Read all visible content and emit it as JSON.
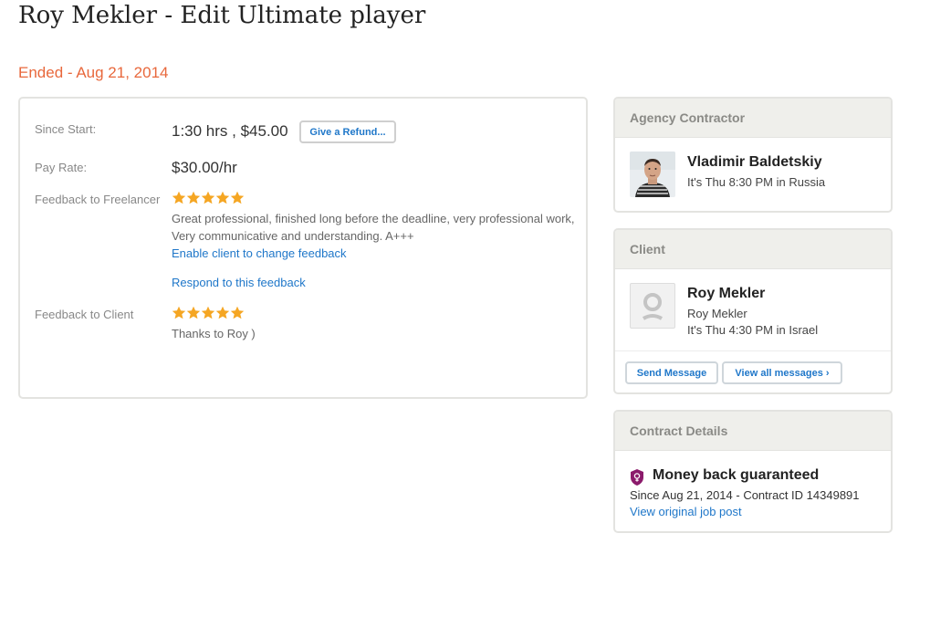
{
  "page": {
    "title": "Roy Mekler - Edit Ultimate player",
    "status": "Ended - Aug 21, 2014"
  },
  "summary": {
    "since_start_label": "Since Start:",
    "since_start_value": "1:30 hrs , $45.00",
    "refund_button": "Give a Refund...",
    "pay_rate_label": "Pay Rate:",
    "pay_rate_value": "$30.00/hr",
    "feedback_freelancer_label": "Feedback to Freelancer",
    "feedback_freelancer_rating": 5,
    "feedback_freelancer_text": "Great professional, finished long before the deadline, very professional work, Very communicative and understanding. A+++",
    "enable_change_link": "Enable client to change feedback",
    "respond_link": "Respond to this feedback",
    "feedback_client_label": "Feedback to Client",
    "feedback_client_rating": 5,
    "feedback_client_text": "Thanks to Roy )"
  },
  "agency": {
    "heading": "Agency Contractor",
    "name": "Vladimir Baldetskiy",
    "local_time": "It's Thu 8:30 PM in Russia"
  },
  "client": {
    "heading": "Client",
    "name": "Roy Mekler",
    "subname": "Roy Mekler",
    "local_time": "It's Thu 4:30 PM in Israel",
    "send_message_button": "Send Message",
    "view_messages_button": "View all messages ›"
  },
  "contract": {
    "heading": "Contract Details",
    "guarantee": "Money back guaranteed",
    "since_line": "Since Aug 21, 2014 - Contract ID 14349891",
    "view_post_link": "View original job post"
  },
  "colors": {
    "accent_link": "#1f77c9",
    "status_orange": "#e8683c",
    "star_gold": "#f5a623",
    "shield_purple": "#8b1a6b"
  }
}
